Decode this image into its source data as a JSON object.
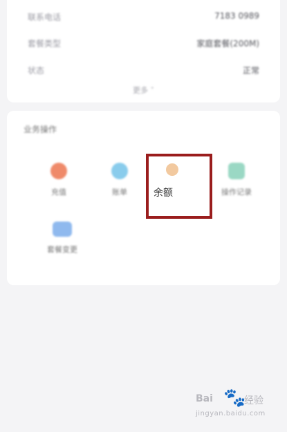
{
  "info": {
    "rows": [
      {
        "label": "联系电话",
        "value": "7183 0989"
      },
      {
        "label": "套餐类型",
        "value": "家庭套餐(200M)"
      },
      {
        "label": "状态",
        "value": "正常"
      }
    ],
    "more_label": "更多 ˅"
  },
  "operations": {
    "title": "业务操作",
    "items": [
      {
        "label": "充值",
        "icon": "recharge-icon"
      },
      {
        "label": "账单",
        "icon": "bill-icon"
      },
      {
        "label": "余额",
        "icon": "balance-icon"
      },
      {
        "label": "操作记录",
        "icon": "records-icon"
      },
      {
        "label": "套餐变更",
        "icon": "package-icon"
      }
    ]
  },
  "highlight_color": "#9a1d1d",
  "watermark": {
    "brand": "Bai",
    "brand_suffix": "经验",
    "url": "jingyan.baidu.com"
  }
}
